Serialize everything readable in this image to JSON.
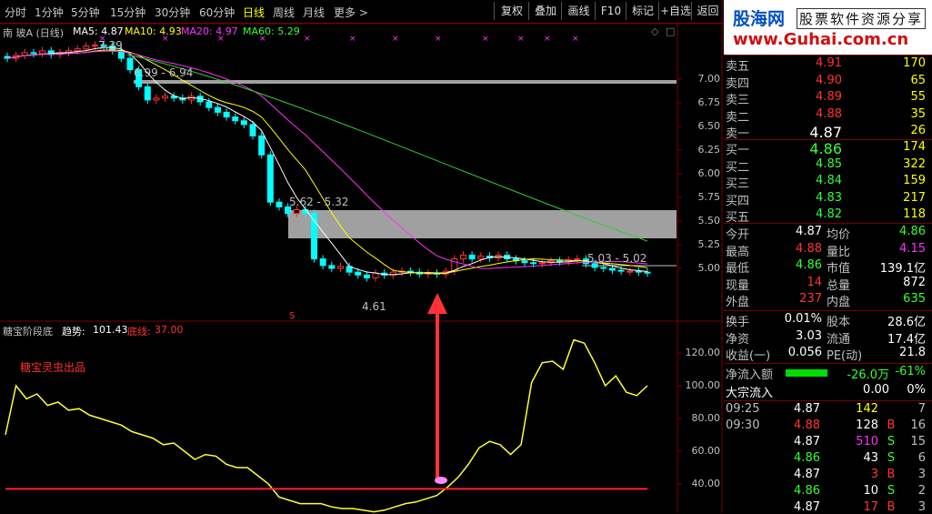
{
  "toolbar": {
    "timeframes": [
      "分时",
      "1分钟",
      "5分钟",
      "15分钟",
      "30分钟",
      "60分钟",
      "日线",
      "周线",
      "月线",
      "更多 >"
    ],
    "active_index": 6,
    "buttons": [
      "复权",
      "叠加",
      "画线",
      "F10",
      "标记",
      "+自选",
      "返回"
    ]
  },
  "watermark": {
    "line1": "股海网",
    "line2": "股票软件资源分享",
    "line3": "www.Guhai.com.cn"
  },
  "kline": {
    "header": {
      "name": "南 玻A (日线)",
      "ma5": "MA5: 4.87",
      "ma10": "MA10: 4.93",
      "ma20": "MA20: 4.97",
      "ma60": "MA60: 5.29"
    },
    "y_ticks": [
      "7.00",
      "6.75",
      "6.50",
      "6.25",
      "6.00",
      "5.75",
      "5.50",
      "5.25",
      "5.00"
    ],
    "notes": {
      "high": "7.39",
      "band1": "6.99 - 6.94",
      "band2": "5.62 - 5.32",
      "band3": "5.03 - 5.02",
      "low": "4.61",
      "signal": "S"
    },
    "closes": [
      7.22,
      7.25,
      7.28,
      7.27,
      7.3,
      7.26,
      7.28,
      7.3,
      7.32,
      7.35,
      7.36,
      7.35,
      7.3,
      7.22,
      7.1,
      6.92,
      6.78,
      6.8,
      6.82,
      6.8,
      6.78,
      6.82,
      6.76,
      6.7,
      6.65,
      6.6,
      6.56,
      6.52,
      6.4,
      6.2,
      5.7,
      5.65,
      5.58,
      5.62,
      5.58,
      5.1,
      5.03,
      5.0,
      5.02,
      4.96,
      4.93,
      4.9,
      4.95,
      4.93,
      4.96,
      4.97,
      4.96,
      4.94,
      4.95,
      4.94,
      4.97,
      5.1,
      5.14,
      5.1,
      5.13,
      5.11,
      5.14,
      5.1,
      5.08,
      5.06,
      5.05,
      5.06,
      5.08,
      5.07,
      5.09,
      5.1,
      5.05,
      5.01,
      5.0,
      4.98,
      4.97,
      4.97,
      4.96,
      4.95
    ]
  },
  "indicator": {
    "title": "糖宝阶段底",
    "trend_label": "趋势:",
    "trend_value": "101.43",
    "base_label": "底线:",
    "base_value": "37.00",
    "brand": "糖宝灵虫出品",
    "y_ticks": [
      "120.00",
      "100.00",
      "80.00",
      "60.00",
      "40.00"
    ],
    "base_level": 37,
    "trend": [
      70,
      100,
      92,
      95,
      88,
      90,
      85,
      86,
      82,
      80,
      78,
      76,
      72,
      70,
      68,
      64,
      65,
      60,
      55,
      58,
      57,
      52,
      50,
      50,
      45,
      40,
      32,
      30,
      28,
      28,
      28,
      26,
      25,
      25,
      24,
      23,
      24,
      26,
      28,
      29,
      31,
      33,
      38,
      44,
      52,
      62,
      66,
      64,
      58,
      64,
      102,
      114,
      115,
      110,
      128,
      126,
      114,
      100,
      106,
      96,
      94,
      100
    ]
  },
  "quote": {
    "partial_label": "4",
    "sell": [
      {
        "label": "卖五",
        "price": "4.91",
        "vol": "170"
      },
      {
        "label": "卖四",
        "price": "4.90",
        "vol": "65"
      },
      {
        "label": "卖三",
        "price": "4.89",
        "vol": "55"
      },
      {
        "label": "卖二",
        "price": "4.88",
        "vol": "35"
      },
      {
        "label": "卖一",
        "price": "4.87",
        "vol": "26"
      }
    ],
    "buy": [
      {
        "label": "买一",
        "price": "4.86",
        "vol": "174"
      },
      {
        "label": "买二",
        "price": "4.85",
        "vol": "322"
      },
      {
        "label": "买三",
        "price": "4.84",
        "vol": "159"
      },
      {
        "label": "买四",
        "price": "4.83",
        "vol": "217"
      },
      {
        "label": "买五",
        "price": "4.82",
        "vol": "118"
      }
    ],
    "stats": [
      {
        "l1": "今开",
        "v1": "4.87",
        "c1": "wht",
        "l2": "均价",
        "v2": "4.86",
        "c2": "grn"
      },
      {
        "l1": "最高",
        "v1": "4.88",
        "c1": "red",
        "l2": "量比",
        "v2": "4.15",
        "c2": "mag"
      },
      {
        "l1": "最低",
        "v1": "4.86",
        "c1": "grn",
        "l2": "市值",
        "v2": "139.1亿",
        "c2": "wht"
      },
      {
        "l1": "现量",
        "v1": "14",
        "c1": "red",
        "l2": "总量",
        "v2": "872",
        "c2": "wht"
      },
      {
        "l1": "外盘",
        "v1": "237",
        "c1": "red",
        "l2": "内盘",
        "v2": "635",
        "c2": "grn"
      }
    ],
    "fin": [
      {
        "l1": "换手",
        "v1": "0.01%",
        "l2": "股本",
        "v2": "28.6亿"
      },
      {
        "l1": "净资",
        "v1": "3.03",
        "l2": "流通",
        "v2": "17.4亿"
      },
      {
        "l1": "收益(一)",
        "v1": "0.056",
        "l2": "PE(动)",
        "v2": "21.8"
      }
    ],
    "flow": {
      "l1": "净流入额",
      "v1": "-26.0万",
      "p1": "-61%",
      "l2": "大宗流入",
      "v2": "0.00",
      "p2": "0%"
    },
    "ticks": [
      {
        "t": "09:25",
        "p": "4.87",
        "pc": "wht",
        "v": "142",
        "vc": "yel",
        "s": "",
        "n": "7"
      },
      {
        "t": "09:30",
        "p": "4.88",
        "pc": "red",
        "v": "128",
        "vc": "wht",
        "s": "B",
        "n": "16"
      },
      {
        "t": "",
        "p": "4.87",
        "pc": "wht",
        "v": "510",
        "vc": "mag",
        "s": "S",
        "n": "15"
      },
      {
        "t": "",
        "p": "4.86",
        "pc": "grn",
        "v": "43",
        "vc": "wht",
        "s": "S",
        "n": "6"
      },
      {
        "t": "",
        "p": "4.87",
        "pc": "wht",
        "v": "3",
        "vc": "red",
        "s": "B",
        "n": "3"
      },
      {
        "t": "",
        "p": "4.86",
        "pc": "grn",
        "v": "10",
        "vc": "wht",
        "s": "S",
        "n": "2"
      },
      {
        "t": "",
        "p": "4.87",
        "pc": "wht",
        "v": "17",
        "vc": "red",
        "s": "B",
        "n": "3"
      }
    ]
  }
}
